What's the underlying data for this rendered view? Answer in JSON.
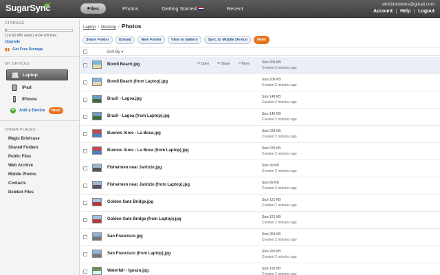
{
  "app": {
    "logo": "SugarSync"
  },
  "nav": {
    "tabs": [
      "Files",
      "Photos",
      "Getting Started",
      "Recent"
    ],
    "active": "Files"
  },
  "user": {
    "email": "whichbirdwins@gmail.com",
    "links": [
      "Account",
      "Help",
      "Logout"
    ]
  },
  "sidebar": {
    "storage": {
      "title": "STORAGE",
      "used_text": "114.60 MB used | 4.64 GB free",
      "percent_used": 2,
      "upgrade": "Upgrade",
      "free_storage": "Get Free Storage"
    },
    "devices": {
      "title": "MY DEVICES",
      "items": [
        "Laptop",
        "iPad",
        "iPhone"
      ],
      "active": "Laptop",
      "add": "Add a Device",
      "new_badge": "New!"
    },
    "places": {
      "title": "OTHER PLACES",
      "items": [
        "Magic Briefcase",
        "Shared Folders",
        "Public Files",
        "Web Archive",
        "Mobile Photos",
        "Contacts",
        "Deleted Files"
      ]
    }
  },
  "main": {
    "breadcrumb": {
      "items": [
        "Laptop",
        "Desktop"
      ],
      "current": "Photos"
    },
    "toolbar": {
      "buttons": [
        "Share Folder",
        "Upload",
        "New Folder",
        "View in Gallery",
        "Sync to Mobile Device"
      ],
      "new_badge": "New!"
    },
    "sort_label": "Sort By ▾",
    "row_actions": [
      "Open",
      "Share",
      "More"
    ],
    "files": [
      {
        "name": "Bondi Beach.jpg",
        "size": "Size 206 KB",
        "created": "Created 2 minutes ago"
      },
      {
        "name": "Bondi Beach (from Laptop).jpg",
        "size": "Size 206 KB",
        "created": "Created 2 minutes ago"
      },
      {
        "name": "Brazil - Lagoa.jpg",
        "size": "Size 146 KB",
        "created": "Created 2 minutes ago"
      },
      {
        "name": "Brazil - Lagoa (from Laptop).jpg",
        "size": "Size 146 KB",
        "created": "Created 2 minutes ago"
      },
      {
        "name": "Buenos Aires - La Boca.jpg",
        "size": "Size 233 KB",
        "created": "Created 2 minutes ago"
      },
      {
        "name": "Buenos Aires - La Boca (from Laptop).jpg",
        "size": "Size 233 KB",
        "created": "Created 2 minutes ago"
      },
      {
        "name": "Fishermen near Janitzio.jpg",
        "size": "Size 99 KB",
        "created": "Created 2 minutes ago"
      },
      {
        "name": "Fishermen near Janitzio (from Laptop).jpg",
        "size": "Size 99 KB",
        "created": "Created 2 minutes ago"
      },
      {
        "name": "Golden Gate Bridge.jpg",
        "size": "Size 121 KB",
        "created": "Created 2 minutes ago"
      },
      {
        "name": "Golden Gate Bridge (from Laptop).jpg",
        "size": "Size 121 KB",
        "created": "Created 2 minutes ago"
      },
      {
        "name": "San Francisco.jpg",
        "size": "Size 265 KB",
        "created": "Created 2 minutes ago"
      },
      {
        "name": "San Francisco (from Laptop).jpg",
        "size": "Size 265 KB",
        "created": "Created 2 minutes ago"
      },
      {
        "name": "Waterfall - Iguazu.jpg",
        "size": "Size 190 KB",
        "created": "Created 2 minutes ago"
      }
    ]
  },
  "colors": {
    "accent": "#2266bb",
    "badge": "#e8731c",
    "storage_fill": "#7cbd3c",
    "topbar": "#4a4a4a"
  }
}
